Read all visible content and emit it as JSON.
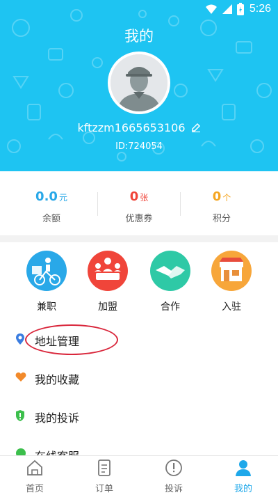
{
  "status_bar": {
    "time": "5:26"
  },
  "header": {
    "title": "我的",
    "username": "kftzzm1665653106",
    "user_id": "ID:724054"
  },
  "stats": [
    {
      "value": "0.0",
      "unit": "元",
      "label": "余额",
      "color": "#29a8e8"
    },
    {
      "value": "0",
      "unit": "张",
      "label": "优惠券",
      "color": "#f0453a"
    },
    {
      "value": "0",
      "unit": "个",
      "label": "积分",
      "color": "#f5a623"
    }
  ],
  "services": [
    {
      "label": "兼职",
      "icon": "courier-bike-icon",
      "color": "#29a8e8"
    },
    {
      "label": "加盟",
      "icon": "meeting-group-icon",
      "color": "#f0453a"
    },
    {
      "label": "合作",
      "icon": "handshake-icon",
      "color": "#2ec9a6"
    },
    {
      "label": "入驻",
      "icon": "storefront-icon",
      "color": "#f7a63a"
    }
  ],
  "menu": [
    {
      "label": "地址管理",
      "icon": "location-pin-icon"
    },
    {
      "label": "我的收藏",
      "icon": "heart-icon"
    },
    {
      "label": "我的投诉",
      "icon": "shield-alert-icon"
    },
    {
      "label": "在线客服",
      "icon": "chat-icon"
    }
  ],
  "bottom_nav": [
    {
      "label": "首页",
      "icon": "home-icon"
    },
    {
      "label": "订单",
      "icon": "order-list-icon"
    },
    {
      "label": "投诉",
      "icon": "complaint-icon"
    },
    {
      "label": "我的",
      "icon": "profile-icon",
      "active": true
    }
  ],
  "colors": {
    "header_bg": "#1ec4f2",
    "accent": "#1ea8ea",
    "highlight": "#d9263b"
  }
}
